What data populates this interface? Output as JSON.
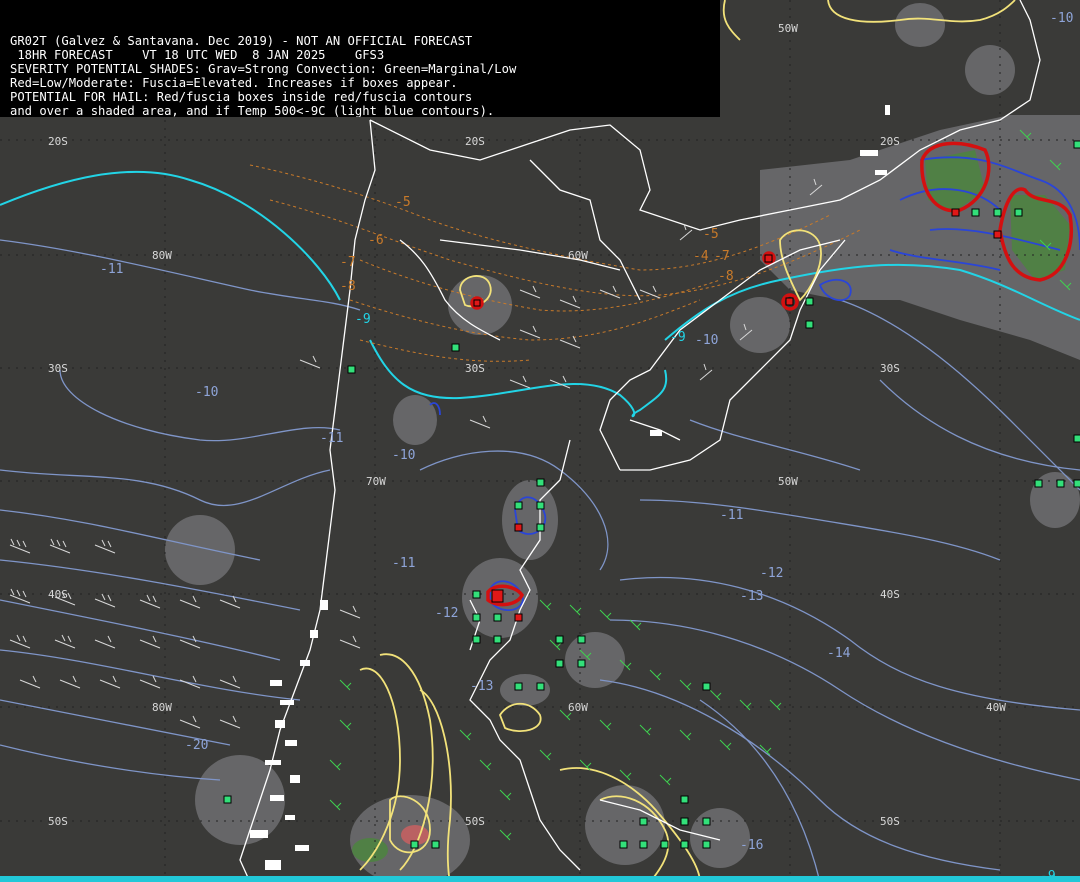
{
  "header": {
    "line1": "GR02T (Galvez & Santavana. Dec 2019) - NOT AN OFFICIAL FORECAST",
    "line2": " 18HR FORECAST    VT 18 UTC WED  8 JAN 2025    GFS3",
    "line3": "SEVERITY POTENTIAL SHADES: Grav=Strong Convection: Green=Marginal/Low",
    "line4": "Red=Low/Moderate: Fuscia=Elevated. Increases if boxes appear.",
    "line5": "POTENTIAL FOR HAIL: Red/fuscia boxes inside red/fuscia contours",
    "line6": "and over a shaded area, and if Temp 500<-9C (light blue contours)."
  },
  "grid_labels": {
    "lat_20s_a": "20S",
    "lat_20s_b": "20S",
    "lat_20s_c": "20S",
    "lat_30s_a": "30S",
    "lat_30s_b": "30S",
    "lat_30s_c": "30S",
    "lat_40s_a": "40S",
    "lat_40s_b": "40S",
    "lat_50s_a": "50S",
    "lat_50s_b": "50S",
    "lat_50s_c": "50S",
    "lon_80w_a": "80W",
    "lon_80w_b": "80W",
    "lon_70w": "70W",
    "lon_60w_a": "60W",
    "lon_60w_b": "60W",
    "lon_50w_a": "50W",
    "lon_50w_b": "50W",
    "lon_40w": "40W"
  },
  "temp_labels": {
    "t1": "-11",
    "t2": "-10",
    "t3": "-11",
    "t4": "-10",
    "t5": "-11",
    "t6": "-12",
    "t7": "-13",
    "t8": "-14",
    "t9": "-11",
    "t10": "-12",
    "t11": "-20",
    "t12": "-16",
    "t13": "-10",
    "t14": "-9",
    "t15": "-9",
    "t16": "-9",
    "t17": "-13",
    "t18": "-10"
  },
  "orange_labels": {
    "o1": "-5",
    "o2": "-6",
    "o3": "-7",
    "o4": "-8",
    "o5": "-5",
    "o6": "-7",
    "o7": "-8",
    "o8": "-4"
  },
  "colors": {
    "background": "#3a3a38",
    "coastline": "#ffffff",
    "temp_contour": "#7f95c8",
    "cyan_contour": "#22d4e6",
    "orange_contour": "#c87a2a",
    "yellow_contour": "#f2e27a",
    "red_contour": "#d41010",
    "green_box": "#33e07a",
    "red_box": "#e01818",
    "shade_gray": "#8a8a90",
    "shade_green": "#4a8a3a"
  }
}
